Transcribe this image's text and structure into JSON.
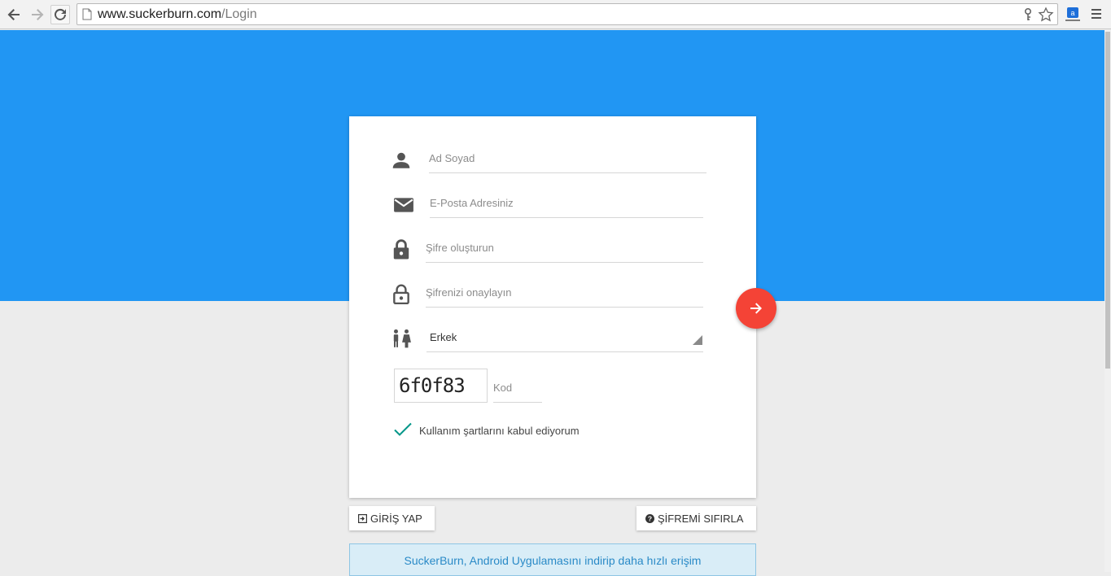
{
  "browser": {
    "url_host": "www.suckerburn.com",
    "url_path": "/Login"
  },
  "form": {
    "name_placeholder": "Ad Soyad",
    "email_placeholder": "E-Posta Adresiniz",
    "password_placeholder": "Şifre oluşturun",
    "password_confirm_placeholder": "Şifrenizi onaylayın",
    "gender_value": "Erkek",
    "captcha_text": "6f0f83",
    "code_placeholder": "Kod",
    "terms_label": "Kullanım şartlarını kabul ediyorum"
  },
  "buttons": {
    "login_label": "GİRİŞ YAP",
    "reset_label": "ŞİFREMİ SIFIRLA"
  },
  "banner": {
    "text": "SuckerBurn, Android Uygulamasını indirip daha hızlı erişim"
  },
  "colors": {
    "header_blue": "#2196f3",
    "submit_red": "#f44336",
    "check_teal": "#009688",
    "banner_bg": "#d9edf7"
  }
}
